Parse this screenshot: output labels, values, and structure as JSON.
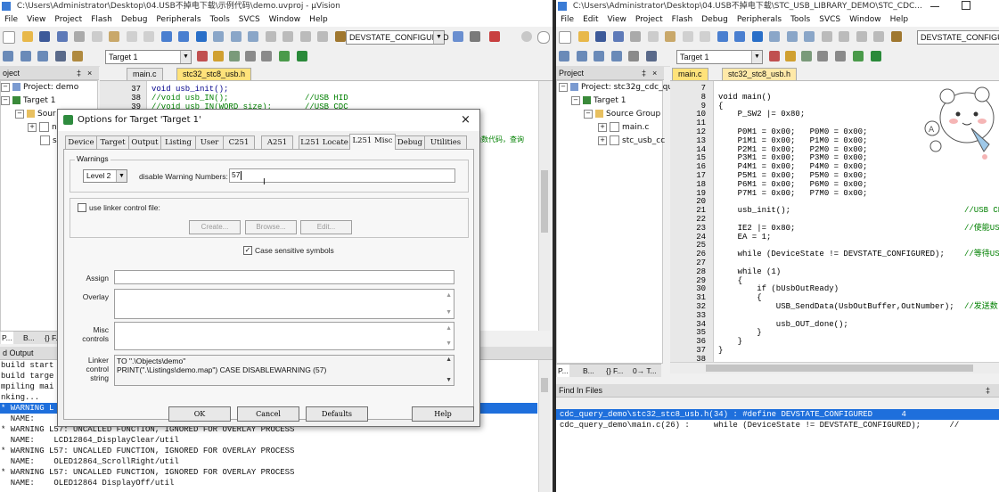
{
  "left_window": {
    "title": "C:\\Users\\Administrator\\Desktop\\04.USB不掉电下载\\示例代码\\demo.uvproj - µVision",
    "menu": [
      "File",
      "View",
      "Project",
      "Flash",
      "Debug",
      "Peripherals",
      "Tools",
      "SVCS",
      "Window",
      "Help"
    ],
    "toolbar": {
      "define_combo": "DEVSTATE_CONFIGURED",
      "target_combo": "Target 1"
    },
    "project_panel": {
      "header": "oject",
      "items": [
        "Project: demo",
        "Target 1",
        "Sour",
        "n",
        "s"
      ]
    },
    "editor_tabs": [
      "main.c",
      "stc32_stc8_usb.h"
    ],
    "code": {
      "lines": [
        {
          "n": "37",
          "text": "void usb_init();"
        },
        {
          "n": "38",
          "text": "//void usb_IN();"
        },
        {
          "n": "39",
          "text": "//void usb_IN(WORD size);"
        }
      ],
      "comments": [
        "//USB HID",
        "//USB CDC"
      ],
      "side_note": "函数代码，查询"
    },
    "panel_tabs": [
      "P...",
      "B...",
      "{} F..."
    ],
    "output": {
      "header": "d Output",
      "lines": [
        "build start",
        "build targe",
        "mpiling mai",
        "nking...",
        "* WARNING L",
        "  NAME:",
        "* WARNING L57: UNCALLED FUNCTION, IGNORED FOR OVERLAY PROCESS",
        "  NAME:    LCD12864_DisplayClear/util",
        "* WARNING L57: UNCALLED FUNCTION, IGNORED FOR OVERLAY PROCESS",
        "  NAME:    OLED12864_ScrollRight/util",
        "* WARNING L57: UNCALLED FUNCTION, IGNORED FOR OVERLAY PROCESS",
        "  NAME:    OLED12864 DisplayOff/util"
      ],
      "highlighted_index": 4
    }
  },
  "dialog": {
    "title": "Options for Target 'Target 1'",
    "close": "×",
    "tabs": [
      "Device",
      "Target",
      "Output",
      "Listing",
      "User",
      "C251",
      "A251",
      "L251 Locate",
      "L251 Misc",
      "Debug",
      "Utilities"
    ],
    "active_tab": "L251 Misc",
    "warnings": {
      "group_label": "Warnings",
      "level": "Level 2",
      "disable_label": "disable Warning Numbers:",
      "disable_value": "57"
    },
    "linker_control": {
      "checkbox_label": "use linker control file:",
      "create": "Create...",
      "browse": "Browse...",
      "edit": "Edit..."
    },
    "case_sensitive": {
      "label": "Case sensitive symbols",
      "checked_mark": "✓"
    },
    "fields": {
      "assign": "Assign",
      "overlay": "Overlay",
      "misc_controls_1": "Misc",
      "misc_controls_2": "controls",
      "linker_control_string_1": "Linker",
      "linker_control_string_2": "control",
      "linker_control_string_3": "string",
      "linker_string_line1": "TO \".\\Objects\\demo\"",
      "linker_string_line2": "PRINT(\".\\Listings\\demo.map\") CASE DISABLEWARNING (57)"
    },
    "buttons": {
      "ok": "OK",
      "cancel": "Cancel",
      "defaults": "Defaults",
      "help": "Help"
    }
  },
  "right_window": {
    "title": "C:\\Users\\Administrator\\Desktop\\04.USB不掉电下载\\STC_USB_LIBRARY_DEMO\\STC_CDC...",
    "menu": [
      "File",
      "Edit",
      "View",
      "Project",
      "Flash",
      "Debug",
      "Peripherals",
      "Tools",
      "SVCS",
      "Window",
      "Help"
    ],
    "toolbar": {
      "define_combo": "DEVSTATE_CONFIGURE",
      "target_combo": "Target 1"
    },
    "project_panel": {
      "header": "Project",
      "items": [
        "Project: stc32g_cdc_qu",
        "Target 1",
        "Source Group",
        "main.c",
        "stc_usb_cc"
      ]
    },
    "editor_tabs": [
      "main.c",
      "stc32_stc8_usb.h"
    ],
    "code": {
      "lines": [
        {
          "n": "7",
          "text": ""
        },
        {
          "n": "8",
          "text": "void main()"
        },
        {
          "n": "9",
          "text": "{"
        },
        {
          "n": "10",
          "text": "    P_SW2 |= 0x80;"
        },
        {
          "n": "11",
          "text": ""
        },
        {
          "n": "12",
          "text": "    P0M1 = 0x00;   P0M0 = 0x00;"
        },
        {
          "n": "13",
          "text": "    P1M1 = 0x00;   P1M0 = 0x00;"
        },
        {
          "n": "14",
          "text": "    P2M1 = 0x00;   P2M0 = 0x00;"
        },
        {
          "n": "15",
          "text": "    P3M1 = 0x00;   P3M0 = 0x00;"
        },
        {
          "n": "16",
          "text": "    P4M1 = 0x00;   P4M0 = 0x00;"
        },
        {
          "n": "17",
          "text": "    P5M1 = 0x00;   P5M0 = 0x00;"
        },
        {
          "n": "18",
          "text": "    P6M1 = 0x00;   P6M0 = 0x00;"
        },
        {
          "n": "19",
          "text": "    P7M1 = 0x00;   P7M0 = 0x00;"
        },
        {
          "n": "20",
          "text": ""
        },
        {
          "n": "21",
          "text": "    usb_init();"
        },
        {
          "n": "22",
          "text": ""
        },
        {
          "n": "23",
          "text": "    IE2 |= 0x80;"
        },
        {
          "n": "24",
          "text": "    EA = 1;"
        },
        {
          "n": "25",
          "text": ""
        },
        {
          "n": "26",
          "text": "    while (DeviceState != DEVSTATE_CONFIGURED);"
        },
        {
          "n": "27",
          "text": ""
        },
        {
          "n": "28",
          "text": "    while (1)"
        },
        {
          "n": "29",
          "text": "    {"
        },
        {
          "n": "30",
          "text": "        if (bUsbOutReady)"
        },
        {
          "n": "31",
          "text": "        {"
        },
        {
          "n": "32",
          "text": "            USB_SendData(UsbOutBuffer,OutNumber);"
        },
        {
          "n": "33",
          "text": ""
        },
        {
          "n": "34",
          "text": "            usb_OUT_done();"
        },
        {
          "n": "35",
          "text": "        }"
        },
        {
          "n": "36",
          "text": "    }"
        },
        {
          "n": "37",
          "text": "}"
        },
        {
          "n": "38",
          "text": ""
        }
      ],
      "comments": {
        "21": "//USB CD",
        "23": "//使能US",
        "26": "//等待US",
        "32": "//发送数"
      }
    },
    "panel_tabs": [
      "P...",
      "B...",
      "{} F...",
      "0→ T..."
    ],
    "find_in_files": {
      "header": "Find In Files",
      "lines": [
        "cdc_query_demo\\stc32_stc8_usb.h(34) : #define DEVSTATE_CONFIGURED      4",
        "cdc_query_demo\\main.c(26) :     while (DeviceState != DEVSTATE_CONFIGURED);      //"
      ],
      "highlighted_index": 0
    }
  },
  "colors": {
    "accent": "#1e6fdc",
    "active_tab": "#ffe27a",
    "comment": "#008000",
    "keyword": "#00008b"
  }
}
